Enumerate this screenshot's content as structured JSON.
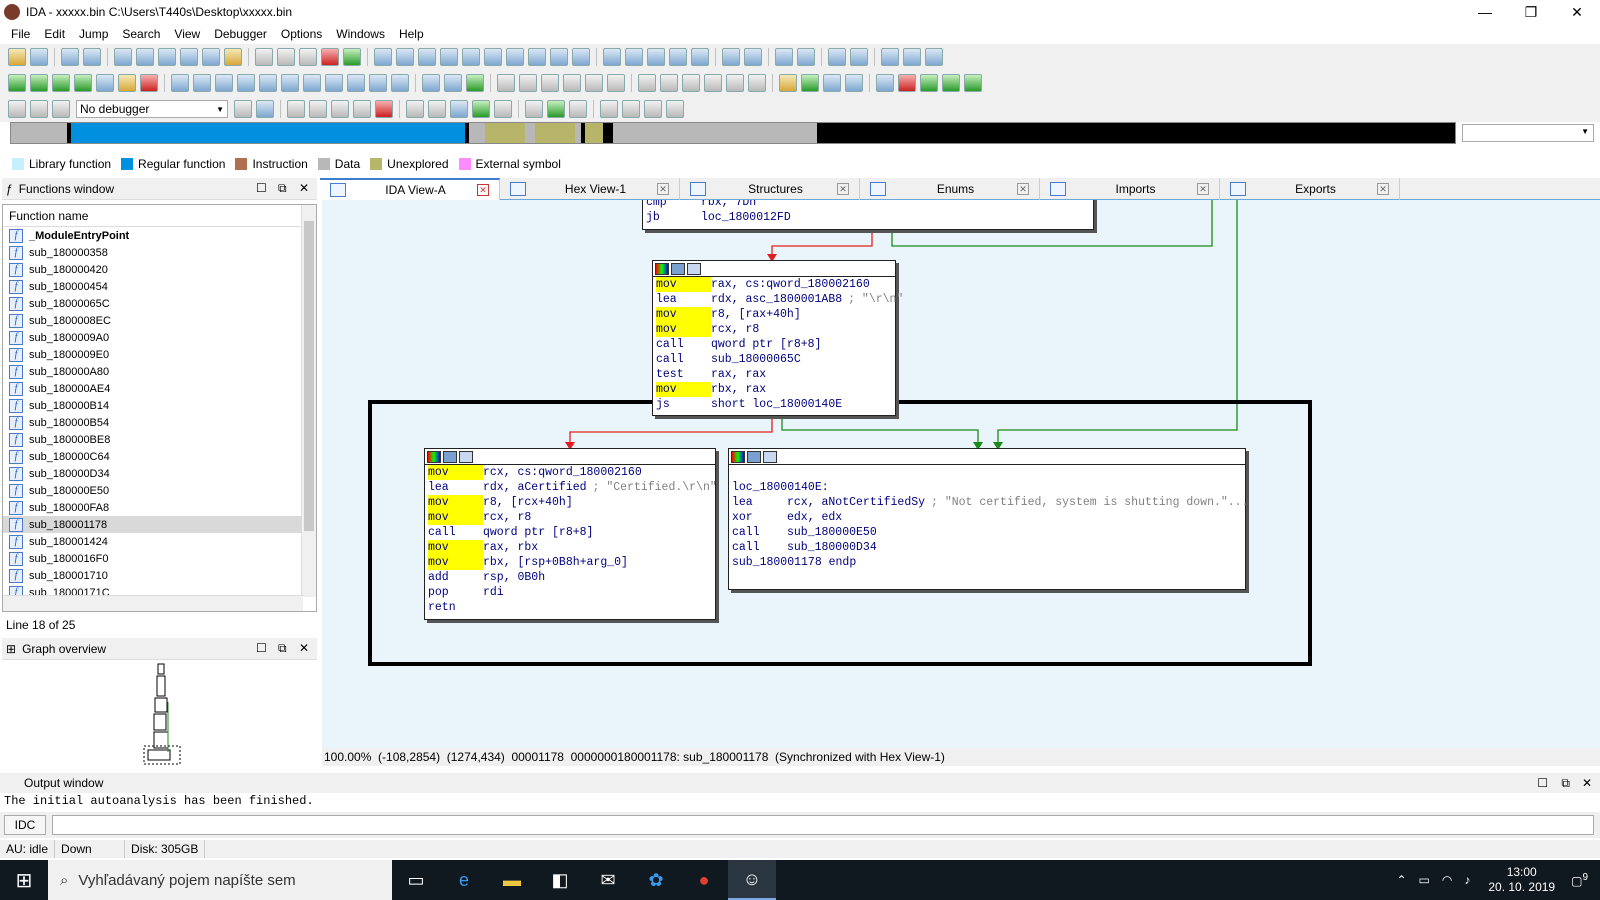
{
  "window": {
    "title": "IDA - xxxxx.bin C:\\Users\\T440s\\Desktop\\xxxxx.bin",
    "min": "—",
    "max": "❐",
    "close": "✕"
  },
  "menu": [
    "File",
    "Edit",
    "Jump",
    "Search",
    "View",
    "Debugger",
    "Options",
    "Windows",
    "Help"
  ],
  "debugger_select": "No debugger",
  "legend": [
    {
      "label": "Library function",
      "color": "#c7f0ff"
    },
    {
      "label": "Regular function",
      "color": "#0090e0"
    },
    {
      "label": "Instruction",
      "color": "#b07050"
    },
    {
      "label": "Data",
      "color": "#b8b8b8"
    },
    {
      "label": "Unexplored",
      "color": "#b7b56a"
    },
    {
      "label": "External symbol",
      "color": "#ff8cff"
    }
  ],
  "functions_window": {
    "title": "Functions window",
    "column": "Function name",
    "items": [
      "_ModuleEntryPoint",
      "sub_180000358",
      "sub_180000420",
      "sub_180000454",
      "sub_18000065C",
      "sub_1800008EC",
      "sub_1800009A0",
      "sub_1800009E0",
      "sub_180000A80",
      "sub_180000AE4",
      "sub_180000B14",
      "sub_180000B54",
      "sub_180000BE8",
      "sub_180000C64",
      "sub_180000D34",
      "sub_180000E50",
      "sub_180000FA8",
      "sub_180001178",
      "sub_180001424",
      "sub_1800016F0",
      "sub_180001710",
      "sub_18000171C"
    ],
    "selected_index": 17,
    "status": "Line 18 of 25"
  },
  "graph_overview": {
    "title": "Graph overview"
  },
  "tabs": [
    {
      "label": "IDA View-A",
      "active": true
    },
    {
      "label": "Hex View-1"
    },
    {
      "label": "Structures"
    },
    {
      "label": "Enums"
    },
    {
      "label": "Imports"
    },
    {
      "label": "Exports"
    }
  ],
  "blocks": {
    "top": [
      [
        "cmp",
        "rbx, 7Dh"
      ],
      [
        "jb",
        "loc_1800012FD"
      ]
    ],
    "mid": [
      [
        "mov",
        "rax, cs:qword_180002160",
        ""
      ],
      [
        "lea",
        "rdx, asc_1800001AB8",
        "; \"\\r\\n\""
      ],
      [
        "mov",
        "r8, [rax+40h]",
        ""
      ],
      [
        "mov",
        "rcx, r8",
        ""
      ],
      [
        "call",
        "qword ptr [r8+8]",
        ""
      ],
      [
        "call",
        "sub_18000065C",
        ""
      ],
      [
        "test",
        "rax, rax",
        ""
      ],
      [
        "mov",
        "rbx, rax",
        ""
      ],
      [
        "js",
        "short loc_18000140E",
        ""
      ]
    ],
    "left": [
      [
        "mov",
        "rcx, cs:qword_180002160",
        ""
      ],
      [
        "lea",
        "rdx, aCertified",
        "; \"Certified.\\r\\n\""
      ],
      [
        "mov",
        "r8, [rcx+40h]",
        ""
      ],
      [
        "mov",
        "rcx, r8",
        ""
      ],
      [
        "call",
        "qword ptr [r8+8]",
        ""
      ],
      [
        "mov",
        "rax, rbx",
        ""
      ],
      [
        "mov",
        "rbx, [rsp+0B8h+arg_0]",
        ""
      ],
      [
        "add",
        "rsp, 0B0h",
        ""
      ],
      [
        "pop",
        "rdi",
        ""
      ],
      [
        "retn",
        "",
        ""
      ]
    ],
    "right_label": "loc_18000140E:",
    "right": [
      [
        "lea",
        "rcx, aNotCertifiedSy",
        "; \"Not certified, system is shutting down.\"..."
      ],
      [
        "xor",
        "edx, edx",
        ""
      ],
      [
        "call",
        "sub_180000E50",
        ""
      ],
      [
        "call",
        "sub_180000D34",
        ""
      ]
    ],
    "right_end": "sub_180001178 endp"
  },
  "graph_status": "100.00%  (-108,2854)  (1274,434)  00001178  0000000180001178: sub_180001178  (Synchronized with Hex View-1)",
  "output": {
    "title": "Output window",
    "text": "The initial autoanalysis has been finished.",
    "idc": "IDC"
  },
  "statusbar": {
    "au": "AU:  idle",
    "dir": "Down",
    "disk": "Disk: 305GB"
  },
  "taskbar": {
    "search": "Vyhľadávaný pojem napíšte sem",
    "time": "13:00",
    "date": "20. 10. 2019",
    "notif": "9"
  }
}
